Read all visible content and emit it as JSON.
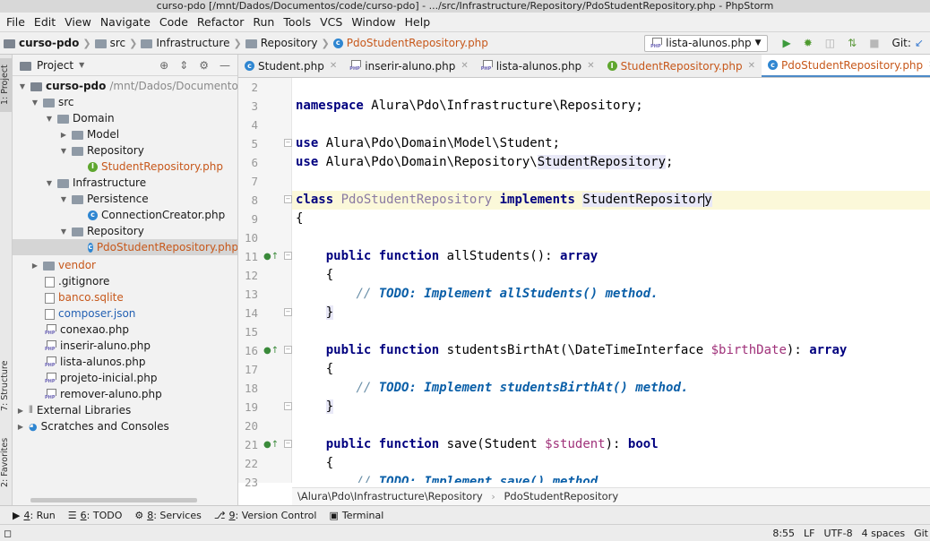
{
  "window": {
    "title": "curso-pdo [/mnt/Dados/Documentos/code/curso-pdo] - .../src/Infrastructure/Repository/PdoStudentRepository.php - PhpStorm"
  },
  "menu": [
    "File",
    "Edit",
    "View",
    "Navigate",
    "Code",
    "Refactor",
    "Run",
    "Tools",
    "VCS",
    "Window",
    "Help"
  ],
  "breadcrumb": [
    "curso-pdo",
    "src",
    "Infrastructure",
    "Repository",
    "PdoStudentRepository.php"
  ],
  "toolbar": {
    "run_config": "lista-alunos.php",
    "git_label": "Git:"
  },
  "left_strip": {
    "project_tab": "1: Project",
    "structure_tab": "7: Structure",
    "favorites_tab": "2: Favorites"
  },
  "project_panel": {
    "title": "Project",
    "tree": [
      {
        "label": "curso-pdo",
        "extra": "/mnt/Dados/Documentos/co",
        "icon": "folder-icon"
      },
      {
        "label": "src",
        "icon": "folder-icon"
      },
      {
        "label": "Domain",
        "icon": "folder-icon"
      },
      {
        "label": "Model",
        "icon": "folder-icon"
      },
      {
        "label": "Repository",
        "icon": "folder-icon"
      },
      {
        "label": "StudentRepository.php",
        "icon": "interface-icon"
      },
      {
        "label": "Infrastructure",
        "icon": "folder-icon"
      },
      {
        "label": "Persistence",
        "icon": "folder-icon"
      },
      {
        "label": "ConnectionCreator.php",
        "icon": "class-icon"
      },
      {
        "label": "Repository",
        "icon": "folder-icon"
      },
      {
        "label": "PdoStudentRepository.php",
        "icon": "class-icon"
      },
      {
        "label": "vendor",
        "icon": "folder-icon"
      },
      {
        "label": ".gitignore",
        "icon": "text-file-icon"
      },
      {
        "label": "banco.sqlite",
        "icon": "text-file-icon"
      },
      {
        "label": "composer.json",
        "icon": "text-file-icon"
      },
      {
        "label": "conexao.php",
        "icon": "php-file-icon"
      },
      {
        "label": "inserir-aluno.php",
        "icon": "php-file-icon"
      },
      {
        "label": "lista-alunos.php",
        "icon": "php-file-icon"
      },
      {
        "label": "projeto-inicial.php",
        "icon": "php-file-icon"
      },
      {
        "label": "remover-aluno.php",
        "icon": "php-file-icon"
      },
      {
        "label": "External Libraries",
        "icon": "library-icon"
      },
      {
        "label": "Scratches and Consoles",
        "icon": "scratches-icon"
      }
    ]
  },
  "editor_tabs": [
    {
      "label": "Student.php",
      "icon": "class-icon"
    },
    {
      "label": "inserir-aluno.php",
      "icon": "php-file-icon"
    },
    {
      "label": "lista-alunos.php",
      "icon": "php-file-icon"
    },
    {
      "label": "StudentRepository.php",
      "icon": "interface-icon"
    },
    {
      "label": "PdoStudentRepository.php",
      "icon": "class-icon"
    }
  ],
  "line_numbers": [
    "2",
    "3",
    "4",
    "5",
    "6",
    "7",
    "8",
    "9",
    "10",
    "11",
    "12",
    "13",
    "14",
    "15",
    "16",
    "17",
    "18",
    "19",
    "20",
    "21",
    "22",
    "23"
  ],
  "code": {
    "l3_kw": "namespace",
    "l3_rest": " Alura\\Pdo\\Infrastructure\\Repository;",
    "l5_kw": "use",
    "l5_rest": " Alura\\Pdo\\Domain\\Model\\Student;",
    "l6_kw": "use",
    "l6_a": " Alura\\Pdo\\Domain\\Repository\\",
    "l6_b": "StudentRepository",
    "l6_c": ";",
    "l8_kw": "class",
    "l8_name": " PdoStudentRepository ",
    "l8_kw2": "implements",
    "l8_sp": " ",
    "l8_iface": "StudentRepositor",
    "l8_iface_end": "y",
    "l9": "{",
    "l11_kw": "public function",
    "l11_name": " allStudents(): ",
    "l11_ret": "array",
    "l12": "{",
    "l13_c": "// ",
    "l13_todo": "TODO: Implement allStudents() method.",
    "l14": "}",
    "l16_kw": "public function",
    "l16_name": " studentsBirthAt(\\DateTimeInterface ",
    "l16_var": "$birthDate",
    "l16_mid": "): ",
    "l16_ret": "array",
    "l17": "{",
    "l18_c": "// ",
    "l18_todo": "TODO: Implement studentsBirthAt() method.",
    "l19": "}",
    "l21_kw": "public function",
    "l21_name": " save(Student ",
    "l21_var": "$student",
    "l21_mid": "): ",
    "l21_ret": "bool",
    "l22": "{",
    "l23_c": "// ",
    "l23_todo": "TODO: Implement save() method."
  },
  "editor_breadcrumb": {
    "namespace": "\\Alura\\Pdo\\Infrastructure\\Repository",
    "class": "PdoStudentRepository"
  },
  "tool_tabs": [
    {
      "num": "4",
      "label": ": Run"
    },
    {
      "num": "6",
      "label": ": TODO"
    },
    {
      "num": "8",
      "label": ": Services"
    },
    {
      "num": "9",
      "label": ": Version Control"
    },
    {
      "num": "",
      "label": "Terminal"
    }
  ],
  "status": {
    "position": "8:55",
    "line_sep": "LF",
    "encoding": "UTF-8",
    "indent": "4 spaces",
    "vcs": "Git"
  }
}
